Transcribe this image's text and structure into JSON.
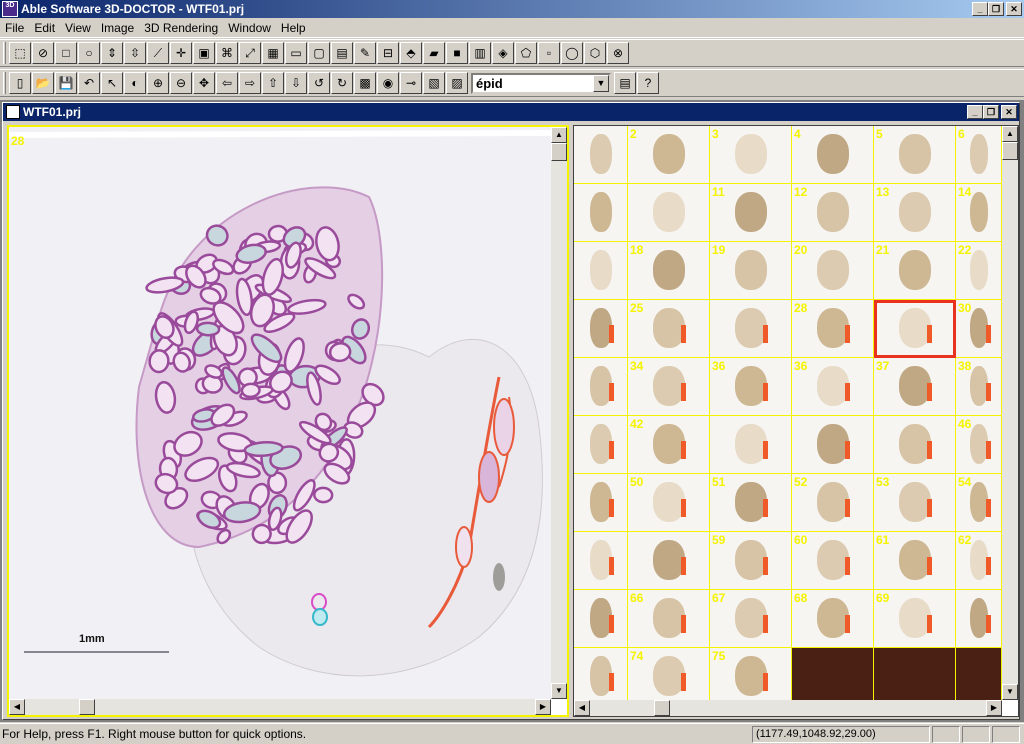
{
  "app": {
    "title": "Able Software 3D-DOCTOR - WTF01.prj",
    "icon_text": "3D"
  },
  "window_controls": {
    "minimize": "_",
    "restore": "❐",
    "close": "✕"
  },
  "menu": [
    {
      "label": "File"
    },
    {
      "label": "Edit"
    },
    {
      "label": "View"
    },
    {
      "label": "Image"
    },
    {
      "label": "3D Rendering"
    },
    {
      "label": "Window"
    },
    {
      "label": "Help"
    }
  ],
  "toolbar1": [
    "select-region-icon",
    "freehand-icon",
    "rectangle-icon",
    "ellipse-icon",
    "move-up-down-icon",
    "move-vertical-icon",
    "line-tool-icon",
    "crosshair-icon",
    "box-icon",
    "node-edit-icon",
    "resize-icon",
    "grid-icon",
    "text-obj-icon",
    "frame-icon",
    "measure-icon",
    "ruler-icon",
    "marker-icon",
    "layer-icon",
    "surface-icon",
    "fill-icon",
    "histogram-icon",
    "shape-select-icon",
    "polygon-icon",
    "square-icon",
    "circle-icon",
    "blob-icon",
    "cancel-shape-icon"
  ],
  "toolbar1_glyphs": [
    "⬚",
    "⊘",
    "□",
    "○",
    "⇕",
    "⇳",
    "⟋",
    "✛",
    "▣",
    "⌘",
    "⤢",
    "▦",
    "▭",
    "▢",
    "▤",
    "✎",
    "⊟",
    "⬘",
    "▰",
    "■",
    "▥",
    "◈",
    "⬠",
    "▫",
    "◯",
    "⬡",
    "⊗"
  ],
  "toolbar2": [
    "new-icon",
    "open-icon",
    "save-icon",
    "undo-icon",
    "pointer-icon",
    "contrast-icon",
    "zoom-in-icon",
    "zoom-out-icon",
    "pan-icon",
    "arrow-left-icon",
    "arrow-right-icon",
    "arrow-up-icon",
    "arrow-down-icon",
    "rotate-ccw-icon",
    "rotate-cw-icon",
    "render-icon",
    "segment-icon",
    "link-icon",
    "stack-icon",
    "color-icon"
  ],
  "toolbar2_glyphs": [
    "▯",
    "📂",
    "💾",
    "↶",
    "↖",
    "◐",
    "⊕",
    "⊖",
    "✥",
    "⇦",
    "⇨",
    "⇧",
    "⇩",
    "↺",
    "↻",
    "▩",
    "◉",
    "⊸",
    "▧",
    "▨"
  ],
  "object_combo": {
    "value": "épid"
  },
  "toolbar2_tail": [
    "object-settings-icon",
    "context-help-icon"
  ],
  "toolbar2_tail_glyphs": [
    "▤",
    "?"
  ],
  "child_window": {
    "title": "WTF01.prj"
  },
  "left_view": {
    "slice_label": "28",
    "scale_label": "1mm"
  },
  "thumbnails": {
    "rows": [
      [
        "",
        "2",
        "3",
        "4",
        "5",
        "6"
      ],
      [
        "",
        "",
        "11",
        "12",
        "13",
        "14"
      ],
      [
        "",
        "18",
        "19",
        "20",
        "21",
        "22"
      ],
      [
        "",
        "25",
        "",
        "28",
        "",
        "30"
      ],
      [
        "",
        "34",
        "36",
        "36",
        "37",
        "38"
      ],
      [
        "",
        "42",
        "",
        "",
        "",
        "46"
      ],
      [
        "",
        "50",
        "51",
        "52",
        "53",
        "54"
      ],
      [
        "",
        "",
        "59",
        "60",
        "61",
        "62"
      ],
      [
        "",
        "66",
        "67",
        "68",
        "69",
        ""
      ],
      [
        "",
        "74",
        "75",
        "",
        "",
        ""
      ]
    ],
    "selected": [
      3,
      4
    ]
  },
  "status": {
    "help_text": "For Help, press F1. Right mouse button for quick options.",
    "coords": "(1177.49,1048.92,29.00)"
  }
}
